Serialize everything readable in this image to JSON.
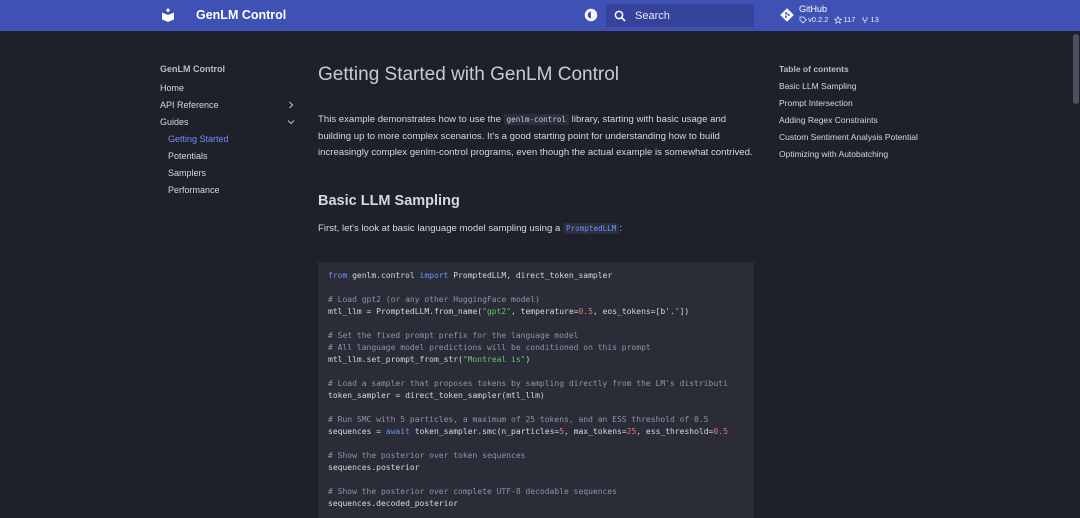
{
  "header": {
    "site_title": "GenLM Control",
    "search_placeholder": "Search",
    "repo": {
      "name": "GitHub",
      "version": "v0.2.2",
      "stars": "117",
      "forks": "13"
    },
    "colors": {
      "primary": "#4051b5",
      "background": "#1e2129",
      "accent": "#6f8dff"
    }
  },
  "sidebar": {
    "title": "GenLM Control",
    "items": [
      {
        "label": "Home"
      },
      {
        "label": "API Reference"
      },
      {
        "label": "Guides"
      },
      {
        "label": "Getting Started"
      },
      {
        "label": "Potentials"
      },
      {
        "label": "Samplers"
      },
      {
        "label": "Performance"
      }
    ]
  },
  "toc": {
    "title": "Table of contents",
    "items": [
      {
        "label": "Basic LLM Sampling"
      },
      {
        "label": "Prompt Intersection"
      },
      {
        "label": "Adding Regex Constraints"
      },
      {
        "label": "Custom Sentiment Analysis Potential"
      },
      {
        "label": "Optimizing with Autobatching"
      }
    ]
  },
  "main": {
    "title": "Getting Started with GenLM Control",
    "intro_pre": "This example demonstrates how to use the ",
    "intro_code": "genlm-control",
    "intro_post": " library, starting with basic usage and building up to more complex scenarios. It's a good starting point for understanding how to build increasingly complex genlm-control programs, even though the actual example is somewhat contrived.",
    "section_title": "Basic LLM Sampling",
    "section_pre": "First, let's look at basic language model sampling using a ",
    "section_code": "PromptedLLM",
    "section_post": ":"
  },
  "code": {
    "l1_kw1": "from",
    "l1_mod": " genlm.control ",
    "l1_kw2": "import",
    "l1_rest": " PromptedLLM, direct_token_sampler",
    "c1": "# Load gpt2 (or any other HuggingFace model)",
    "l2_a": "mtl_llm = PromptedLLM.from_name(",
    "l2_s": "\"gpt2\"",
    "l2_b": ", temperature=",
    "l2_n": "0.5",
    "l2_c": ", eos_tokens=[b'.'])",
    "c2": "# Set the fixed prompt prefix for the language model",
    "c3": "# All language model predictions will be conditioned on this prompt",
    "l3_a": "mtl_llm.set_prompt_from_str(",
    "l3_s": "\"Montreal is\"",
    "l3_b": ")",
    "c4": "# Load a sampler that proposes tokens by sampling directly from the LM's distributi",
    "l4": "token_sampler = direct_token_sampler(mtl_llm)",
    "c5": "# Run SMC with 5 particles, a maximum of 25 tokens, and an ESS threshold of 0.5",
    "l5_a": "sequences = ",
    "l5_kw": "await",
    "l5_b": " token_sampler.smc(n_particles=",
    "l5_n1": "5",
    "l5_c": ", max_tokens=",
    "l5_n2": "25",
    "l5_d": ", ess_threshold=",
    "l5_n3": "0.5",
    "c6": "# Show the posterior over token sequences",
    "l6": "sequences.posterior",
    "c7": "# Show the posterior over complete UTF-8 decodable sequences",
    "l7": "sequences.decoded_posterior"
  }
}
